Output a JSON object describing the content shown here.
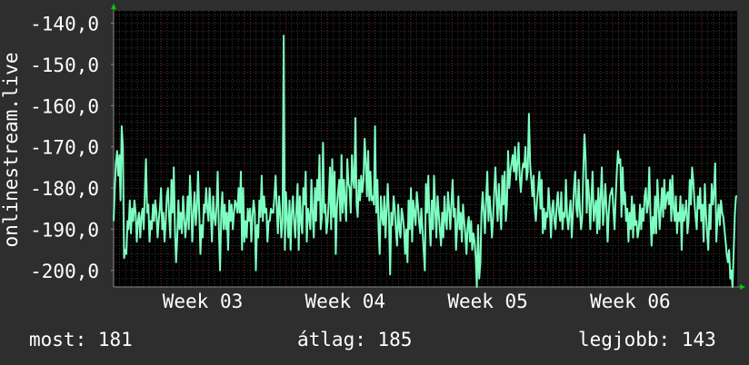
{
  "chart_data": {
    "type": "line",
    "ylabel": "onlinestream.live",
    "ylim": [
      -204,
      -137
    ],
    "x_ticks": [
      {
        "label": "Week 03",
        "x": 15
      },
      {
        "label": "Week 04",
        "x": 39
      },
      {
        "label": "Week 05",
        "x": 63
      },
      {
        "label": "Week 06",
        "x": 87
      }
    ],
    "xlim": [
      0,
      105
    ],
    "y_ticks": [
      {
        "label": "-140,0",
        "value": -140
      },
      {
        "label": "-150,0",
        "value": -150
      },
      {
        "label": "-160,0",
        "value": -160
      },
      {
        "label": "-170,0",
        "value": -170
      },
      {
        "label": "-180,0",
        "value": -180
      },
      {
        "label": "-190,0",
        "value": -190
      },
      {
        "label": "-200,0",
        "value": -200
      }
    ],
    "series": [
      {
        "values": [
          -188,
          -180,
          -174,
          -171,
          -177,
          -172,
          -183,
          -165,
          -170,
          -197,
          -195,
          -196,
          -188,
          -190,
          -183,
          -191,
          -185,
          -188,
          -183,
          -186,
          -193,
          -188,
          -186,
          -192,
          -187,
          -185,
          -190,
          -181,
          -173,
          -186,
          -184,
          -193,
          -188,
          -190,
          -184,
          -188,
          -183,
          -186,
          -192,
          -188,
          -185,
          -180,
          -190,
          -186,
          -193,
          -188,
          -182,
          -180,
          -187,
          -192,
          -178,
          -186,
          -175,
          -190,
          -198,
          -192,
          -183,
          -190,
          -186,
          -191,
          -182,
          -187,
          -192,
          -188,
          -182,
          -190,
          -177,
          -184,
          -193,
          -186,
          -181,
          -189,
          -185,
          -176,
          -186,
          -196,
          -189,
          -192,
          -184,
          -186,
          -180,
          -185,
          -188,
          -180,
          -186,
          -193,
          -182,
          -187,
          -189,
          -184,
          -176,
          -190,
          -200,
          -186,
          -181,
          -190,
          -184,
          -190,
          -186,
          -195,
          -183,
          -188,
          -184,
          -190,
          -186,
          -183,
          -184,
          -186,
          -180,
          -186,
          -176,
          -195,
          -180,
          -193,
          -188,
          -192,
          -185,
          -188,
          -185,
          -193,
          -187,
          -183,
          -186,
          -200,
          -189,
          -192,
          -183,
          -187,
          -177,
          -188,
          -182,
          -186,
          -185,
          -193,
          -188,
          -188,
          -185,
          -186,
          -186,
          -182,
          -177,
          -185,
          -191,
          -182,
          -186,
          -192,
          -188,
          -143,
          -195,
          -181,
          -187,
          -192,
          -183,
          -195,
          -186,
          -182,
          -188,
          -192,
          -185,
          -179,
          -195,
          -182,
          -188,
          -191,
          -180,
          -184,
          -176,
          -193,
          -185,
          -187,
          -190,
          -178,
          -186,
          -192,
          -180,
          -188,
          -178,
          -183,
          -172,
          -190,
          -187,
          -169,
          -186,
          -184,
          -191,
          -188,
          -183,
          -175,
          -190,
          -173,
          -187,
          -176,
          -196,
          -185,
          -181,
          -178,
          -188,
          -172,
          -186,
          -178,
          -183,
          -188,
          -173,
          -179,
          -180,
          -186,
          -172,
          -178,
          -180,
          -163,
          -184,
          -187,
          -178,
          -183,
          -177,
          -181,
          -178,
          -168,
          -174,
          -182,
          -171,
          -183,
          -176,
          -183,
          -182,
          -184,
          -165,
          -186,
          -178,
          -190,
          -196,
          -182,
          -187,
          -189,
          -182,
          -192,
          -185,
          -179,
          -187,
          -201,
          -186,
          -189,
          -182,
          -185,
          -190,
          -194,
          -184,
          -190,
          -192,
          -185,
          -187,
          -190,
          -196,
          -190,
          -198,
          -183,
          -190,
          -180,
          -193,
          -183,
          -186,
          -189,
          -181,
          -184,
          -188,
          -191,
          -185,
          -190,
          -195,
          -200,
          -179,
          -186,
          -177,
          -188,
          -194,
          -183,
          -190,
          -177,
          -185,
          -192,
          -182,
          -186,
          -190,
          -194,
          -186,
          -192,
          -182,
          -188,
          -190,
          -181,
          -185,
          -190,
          -184,
          -178,
          -187,
          -185,
          -195,
          -189,
          -182,
          -190,
          -186,
          -193,
          -184,
          -188,
          -191,
          -196,
          -189,
          -187,
          -193,
          -188,
          -195,
          -191,
          -193,
          -197,
          -204,
          -189,
          -202,
          -198,
          -186,
          -181,
          -186,
          -191,
          -183,
          -176,
          -188,
          -182,
          -186,
          -192,
          -187,
          -181,
          -175,
          -183,
          -188,
          -179,
          -185,
          -190,
          -177,
          -184,
          -176,
          -188,
          -184,
          -171,
          -180,
          -176,
          -174,
          -172,
          -176,
          -170,
          -178,
          -174,
          -169,
          -177,
          -181,
          -176,
          -174,
          -175,
          -170,
          -178,
          -176,
          -162,
          -174,
          -178,
          -182,
          -177,
          -185,
          -188,
          -183,
          -180,
          -176,
          -185,
          -178,
          -191,
          -185,
          -190,
          -186,
          -187,
          -180,
          -185,
          -192,
          -185,
          -183,
          -188,
          -190,
          -184,
          -181,
          -186,
          -188,
          -181,
          -190,
          -186,
          -187,
          -178,
          -187,
          -190,
          -186,
          -183,
          -192,
          -186,
          -180,
          -176,
          -185,
          -187,
          -178,
          -185,
          -190,
          -187,
          -176,
          -167,
          -173,
          -186,
          -178,
          -182,
          -190,
          -183,
          -176,
          -188,
          -185,
          -183,
          -191,
          -180,
          -190,
          -182,
          -175,
          -189,
          -185,
          -179,
          -185,
          -193,
          -186,
          -182,
          -181,
          -180,
          -185,
          -190,
          -182,
          -176,
          -171,
          -174,
          -173,
          -187,
          -175,
          -184,
          -181,
          -188,
          -185,
          -193,
          -186,
          -190,
          -182,
          -192,
          -184,
          -189,
          -188,
          -192,
          -190,
          -184,
          -190,
          -185,
          -188,
          -182,
          -180,
          -186,
          -184,
          -175,
          -186,
          -194,
          -187,
          -191,
          -182,
          -191,
          -178,
          -184,
          -190,
          -185,
          -180,
          -187,
          -178,
          -185,
          -182,
          -181,
          -184,
          -178,
          -188,
          -177,
          -185,
          -188,
          -182,
          -191,
          -186,
          -188,
          -182,
          -195,
          -184,
          -188,
          -186,
          -183,
          -191,
          -188,
          -178,
          -184,
          -175,
          -178,
          -183,
          -187,
          -190,
          -182,
          -185,
          -180,
          -188,
          -184,
          -193,
          -179,
          -186,
          -191,
          -195,
          -184,
          -190,
          -179,
          -184,
          -181,
          -174,
          -193,
          -187,
          -184,
          -189,
          -183,
          -186,
          -187,
          -190,
          -193,
          -196,
          -198,
          -195,
          -202,
          -200,
          -204,
          -195,
          -186,
          -182,
          -182
        ]
      }
    ]
  },
  "stats": {
    "now_label": "most:",
    "now_value": "181",
    "avg_label": "átlag:",
    "avg_value": "185",
    "max_label": "legjobb:",
    "max_value": "143"
  },
  "colors": {
    "background": "#2e2e2e",
    "plot_background": "#000000",
    "line": "#7effc1",
    "grid_minor": "#3a3a3a",
    "grid_major": "#6a2323",
    "axis": "#888888",
    "arrow": "#00cc00",
    "text": "#ffffff"
  }
}
